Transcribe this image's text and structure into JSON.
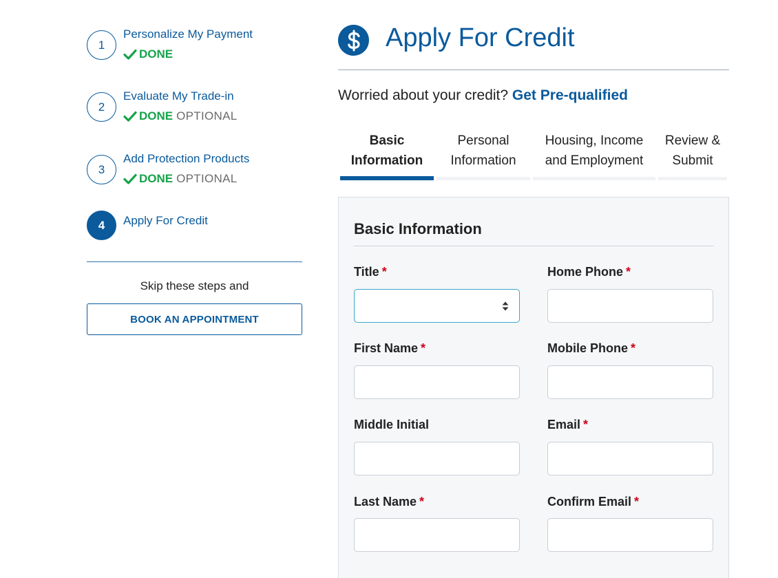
{
  "sidebar": {
    "steps": [
      {
        "number": "1",
        "title": "Personalize My Payment",
        "done_label": "DONE",
        "optional_label": ""
      },
      {
        "number": "2",
        "title": "Evaluate My Trade-in",
        "done_label": "DONE",
        "optional_label": "OPTIONAL"
      },
      {
        "number": "3",
        "title": "Add Protection Products",
        "done_label": "DONE",
        "optional_label": "OPTIONAL"
      },
      {
        "number": "4",
        "title": "Apply For Credit",
        "done_label": "",
        "optional_label": ""
      }
    ],
    "skip_text": "Skip these steps and",
    "book_button": "BOOK AN APPOINTMENT"
  },
  "header": {
    "title": "Apply For Credit",
    "icon": "dollar-sign-icon"
  },
  "prequal": {
    "text": "Worried about your credit?",
    "link": "Get Pre-qualified"
  },
  "tabs": [
    {
      "line1": "Basic",
      "line2": "Information",
      "active": true
    },
    {
      "line1": "Personal",
      "line2": "Information",
      "active": false
    },
    {
      "line1": "Housing, Income",
      "line2": "and Employment",
      "active": false
    },
    {
      "line1": "Review &",
      "line2": "Submit",
      "active": false
    }
  ],
  "form": {
    "section_title": "Basic Information",
    "required_marker": "*",
    "fields": {
      "title": {
        "label": "Title",
        "value": ""
      },
      "first_name": {
        "label": "First Name",
        "value": ""
      },
      "middle_initial": {
        "label": "Middle Initial",
        "value": ""
      },
      "last_name": {
        "label": "Last Name",
        "value": ""
      },
      "home_phone": {
        "label": "Home Phone",
        "value": ""
      },
      "mobile_phone": {
        "label": "Mobile Phone",
        "value": ""
      },
      "email": {
        "label": "Email",
        "value": ""
      },
      "confirm_email": {
        "label": "Confirm Email",
        "value": ""
      }
    }
  },
  "colors": {
    "brand_blue": "#0a5a9c",
    "done_green": "#15a34a",
    "required_red": "#d0021b",
    "focus_border": "#39a8c9"
  }
}
